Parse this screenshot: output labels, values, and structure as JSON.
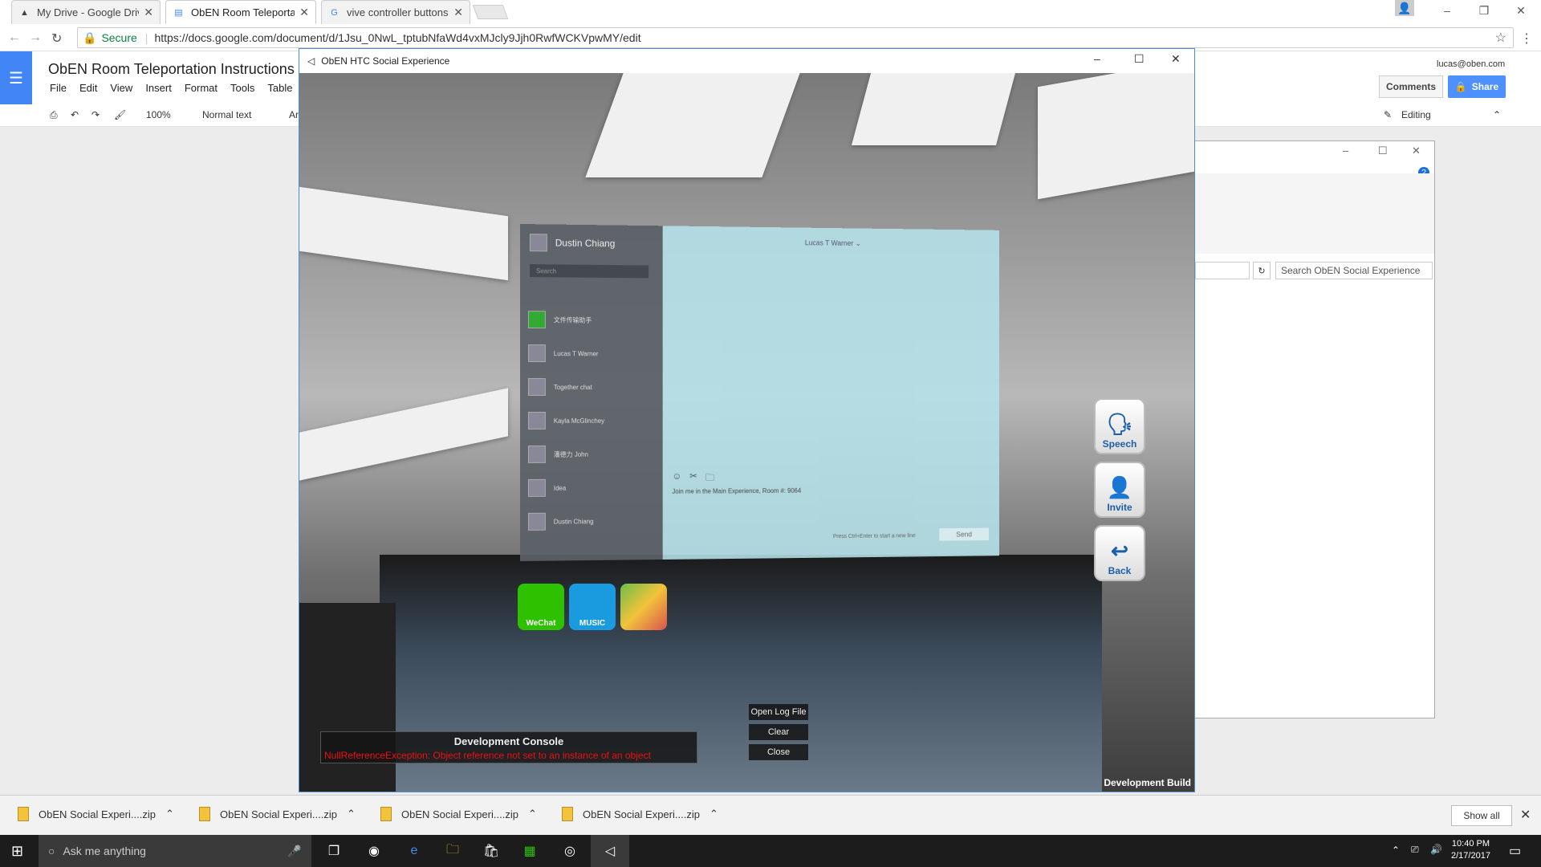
{
  "browser": {
    "tabs": [
      {
        "title": "My Drive - Google Drive",
        "active": false
      },
      {
        "title": "ObEN Room Teleportatic",
        "active": true
      },
      {
        "title": "vive controller buttons -",
        "active": false
      }
    ],
    "secure_label": "Secure",
    "url": "https://docs.google.com/document/d/1Jsu_0NwL_tptubNfaWd4vxMJcly9Jjh0RwfWCKVpwMY/edit"
  },
  "docs": {
    "title": "ObEN Room Teleportation Instructions",
    "menu": [
      "File",
      "Edit",
      "View",
      "Insert",
      "Format",
      "Tools",
      "Table"
    ],
    "user": "lucas@oben.com",
    "comments_label": "Comments",
    "share_label": "Share",
    "zoom": "100%",
    "style": "Normal text",
    "font_partial": "Ar",
    "mode": "Editing"
  },
  "explorer": {
    "search_placeholder": "Search ObEN Social Experience"
  },
  "game": {
    "window_title": "ObEN HTC Social Experience",
    "chat": {
      "me": "Dustin Chiang",
      "search_placeholder": "Search",
      "contacts": [
        "文件传输助手",
        "Lucas T Warner",
        "Together chat",
        "Kayla McGlinchey",
        "潘德力 John",
        "Idea",
        "Dustin Chiang"
      ],
      "conversation_header": "Lucas T Warner ⌄",
      "message": "Join me in the Main Experience, Room #: 9064",
      "hint": "Press Ctrl+Enter to start a new line",
      "send_label": "Send"
    },
    "side_buttons": [
      {
        "label": "Speech",
        "icon": "speech-icon"
      },
      {
        "label": "Invite",
        "icon": "invite-icon"
      },
      {
        "label": "Back",
        "icon": "back-icon"
      }
    ],
    "apps": [
      {
        "label": "WeChat",
        "color": "#2dc100"
      },
      {
        "label": "MUSIC",
        "color": "#1a9be0"
      },
      {
        "label": "",
        "color": "#d9534f"
      }
    ],
    "console": {
      "title": "Development Console",
      "error": "NullReferenceException: Object reference not set to an instance of an object",
      "open_log": "Open Log File",
      "clear": "Clear",
      "close": "Close"
    },
    "build_label": "Development Build"
  },
  "downloads": {
    "items": [
      "ObEN Social Experi....zip",
      "ObEN Social Experi....zip",
      "ObEN Social Experi....zip",
      "ObEN Social Experi....zip"
    ],
    "show_all": "Show all"
  },
  "taskbar": {
    "search_placeholder": "Ask me anything",
    "time": "10:40 PM",
    "date": "2/17/2017"
  }
}
